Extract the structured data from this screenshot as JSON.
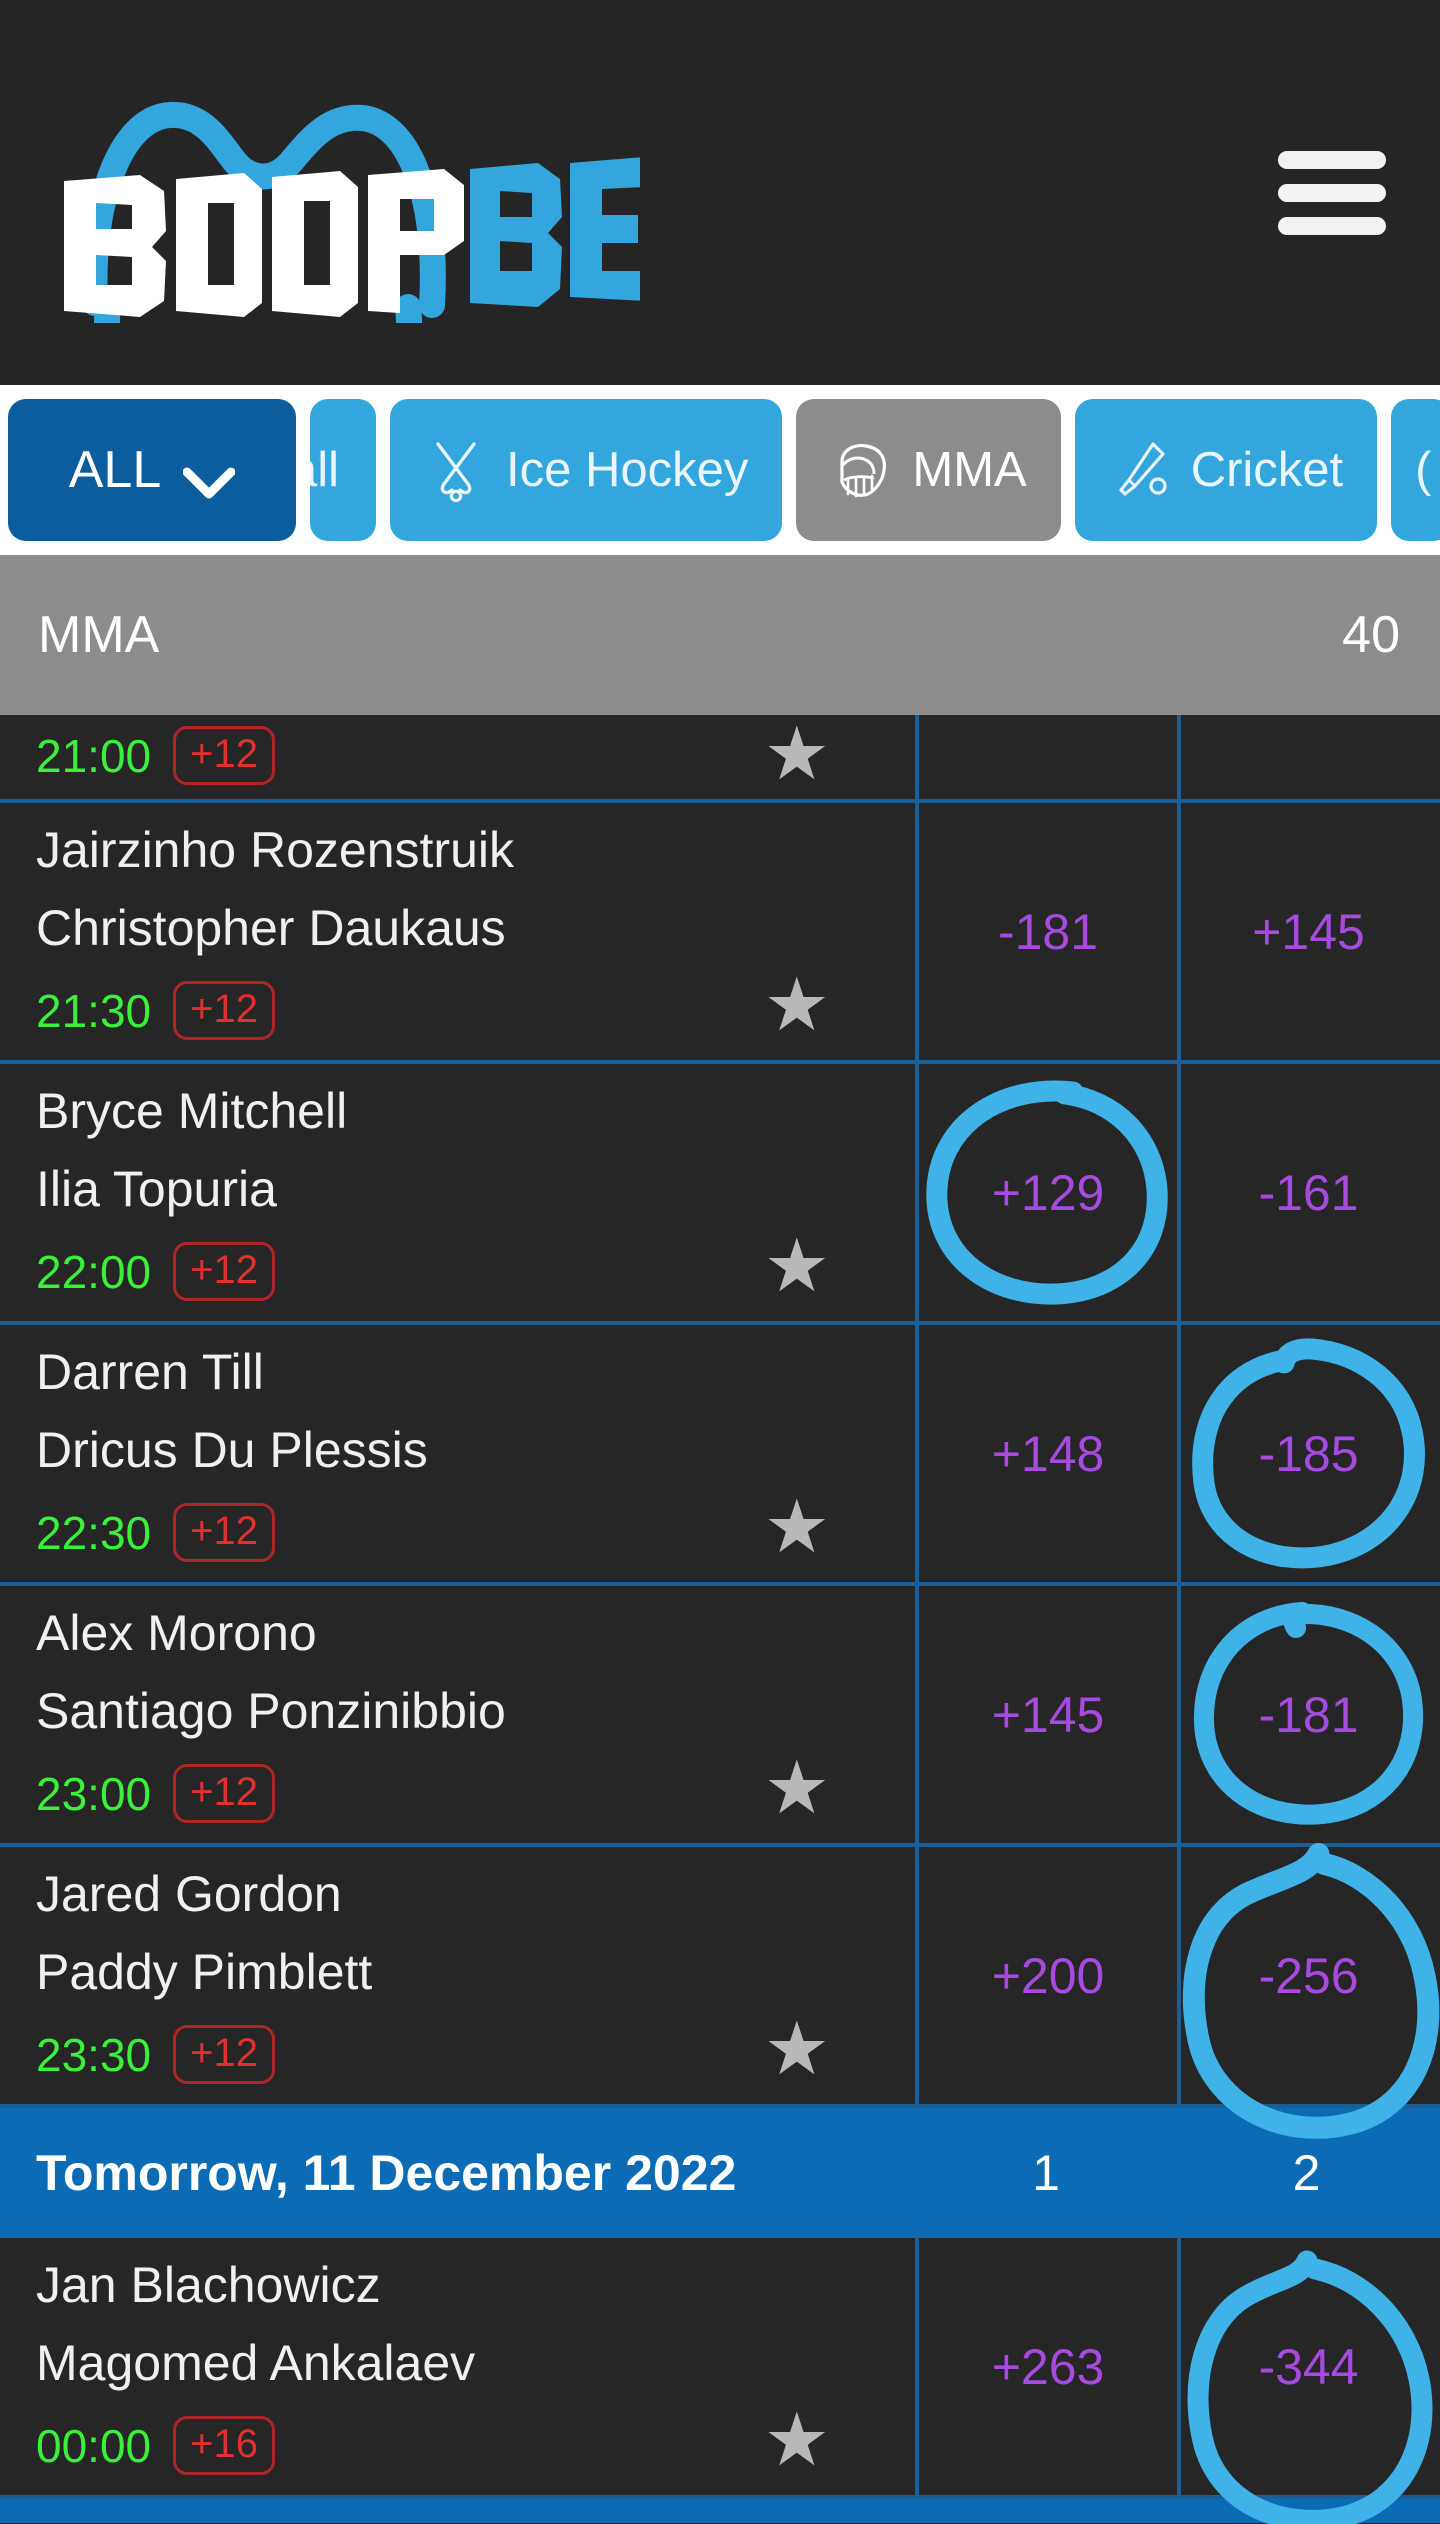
{
  "brand": {
    "name_part1": "BOOP",
    "name_part2": "BET",
    "accent_color": "#33a6dd",
    "menu_icon": "hamburger-menu-icon"
  },
  "navbar": {
    "all_button": {
      "label": "ALL",
      "icon": "chevron-down-icon"
    },
    "tabs": [
      {
        "label": "all",
        "icon": "football-icon",
        "state": "clipped"
      },
      {
        "label": "Ice Hockey",
        "icon": "ice-hockey-sticks-icon",
        "state": "default"
      },
      {
        "label": "MMA",
        "icon": "mma-glove-icon",
        "state": "selected"
      },
      {
        "label": "Cricket",
        "icon": "cricket-bat-ball-icon",
        "state": "default"
      },
      {
        "label": "",
        "icon": "",
        "state": "clipped-right"
      }
    ]
  },
  "league_header": {
    "title": "MMA",
    "count": "40"
  },
  "column_headers": {
    "home": "1",
    "away": "2"
  },
  "date_header": "Tomorrow, 11 December 2022",
  "events": [
    {
      "partial": true,
      "home": "",
      "away": "",
      "kickoff": "21:00",
      "more": "+12",
      "odds_home": "",
      "odds_away": "",
      "circled": ""
    },
    {
      "partial": false,
      "home": "Jairzinho Rozenstruik",
      "away": "Christopher Daukaus",
      "kickoff": "21:30",
      "more": "+12",
      "odds_home": "-181",
      "odds_away": "+145",
      "circled": ""
    },
    {
      "partial": false,
      "home": "Bryce Mitchell",
      "away": "Ilia Topuria",
      "kickoff": "22:00",
      "more": "+12",
      "odds_home": "+129",
      "odds_away": "-161",
      "circled": "home"
    },
    {
      "partial": false,
      "home": "Darren Till",
      "away": "Dricus Du Plessis",
      "kickoff": "22:30",
      "more": "+12",
      "odds_home": "+148",
      "odds_away": "-185",
      "circled": "away"
    },
    {
      "partial": false,
      "home": "Alex Morono",
      "away": "Santiago Ponzinibbio",
      "kickoff": "23:00",
      "more": "+12",
      "odds_home": "+145",
      "odds_away": "-181",
      "circled": "away"
    },
    {
      "partial": false,
      "home": "Jared Gordon",
      "away": "Paddy Pimblett",
      "kickoff": "23:30",
      "more": "+12",
      "odds_home": "+200",
      "odds_away": "-256",
      "circled": "away"
    }
  ],
  "events_tomorrow": [
    {
      "partial": false,
      "home": "Jan Blachowicz",
      "away": "Magomed Ankalaev",
      "kickoff": "00:00",
      "more": "+16",
      "odds_home": "+263",
      "odds_away": "-344",
      "circled": "away"
    }
  ],
  "icons": {
    "favorite": "star-icon",
    "annotation": "hand-drawn-circle-annotation"
  },
  "colors": {
    "page_bg": "#222222",
    "header_bg": "#252525",
    "row_bg": "#262626",
    "row_border": "#1b5e96",
    "tab_blue": "#33a6dd",
    "tab_selected_grey": "#8c8c8c",
    "all_button_blue": "#0b5d9e",
    "date_bar_blue": "#0b6cb5",
    "odds_purple": "#a64ae0",
    "kickoff_green": "#3bf03b",
    "more_red": "#e03030",
    "annotation_blue": "#3fb3e8"
  }
}
